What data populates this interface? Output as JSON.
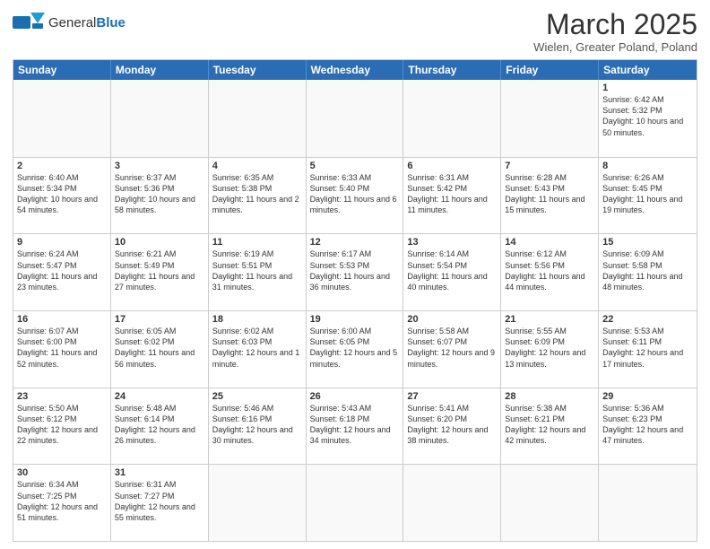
{
  "logo": {
    "text_general": "General",
    "text_blue": "Blue"
  },
  "title": "March 2025",
  "subtitle": "Wielen, Greater Poland, Poland",
  "days_of_week": [
    "Sunday",
    "Monday",
    "Tuesday",
    "Wednesday",
    "Thursday",
    "Friday",
    "Saturday"
  ],
  "weeks": [
    [
      {
        "day": "",
        "info": ""
      },
      {
        "day": "",
        "info": ""
      },
      {
        "day": "",
        "info": ""
      },
      {
        "day": "",
        "info": ""
      },
      {
        "day": "",
        "info": ""
      },
      {
        "day": "",
        "info": ""
      },
      {
        "day": "1",
        "info": "Sunrise: 6:42 AM\nSunset: 5:32 PM\nDaylight: 10 hours and 50 minutes."
      }
    ],
    [
      {
        "day": "2",
        "info": "Sunrise: 6:40 AM\nSunset: 5:34 PM\nDaylight: 10 hours and 54 minutes."
      },
      {
        "day": "3",
        "info": "Sunrise: 6:37 AM\nSunset: 5:36 PM\nDaylight: 10 hours and 58 minutes."
      },
      {
        "day": "4",
        "info": "Sunrise: 6:35 AM\nSunset: 5:38 PM\nDaylight: 11 hours and 2 minutes."
      },
      {
        "day": "5",
        "info": "Sunrise: 6:33 AM\nSunset: 5:40 PM\nDaylight: 11 hours and 6 minutes."
      },
      {
        "day": "6",
        "info": "Sunrise: 6:31 AM\nSunset: 5:42 PM\nDaylight: 11 hours and 11 minutes."
      },
      {
        "day": "7",
        "info": "Sunrise: 6:28 AM\nSunset: 5:43 PM\nDaylight: 11 hours and 15 minutes."
      },
      {
        "day": "8",
        "info": "Sunrise: 6:26 AM\nSunset: 5:45 PM\nDaylight: 11 hours and 19 minutes."
      }
    ],
    [
      {
        "day": "9",
        "info": "Sunrise: 6:24 AM\nSunset: 5:47 PM\nDaylight: 11 hours and 23 minutes."
      },
      {
        "day": "10",
        "info": "Sunrise: 6:21 AM\nSunset: 5:49 PM\nDaylight: 11 hours and 27 minutes."
      },
      {
        "day": "11",
        "info": "Sunrise: 6:19 AM\nSunset: 5:51 PM\nDaylight: 11 hours and 31 minutes."
      },
      {
        "day": "12",
        "info": "Sunrise: 6:17 AM\nSunset: 5:53 PM\nDaylight: 11 hours and 36 minutes."
      },
      {
        "day": "13",
        "info": "Sunrise: 6:14 AM\nSunset: 5:54 PM\nDaylight: 11 hours and 40 minutes."
      },
      {
        "day": "14",
        "info": "Sunrise: 6:12 AM\nSunset: 5:56 PM\nDaylight: 11 hours and 44 minutes."
      },
      {
        "day": "15",
        "info": "Sunrise: 6:09 AM\nSunset: 5:58 PM\nDaylight: 11 hours and 48 minutes."
      }
    ],
    [
      {
        "day": "16",
        "info": "Sunrise: 6:07 AM\nSunset: 6:00 PM\nDaylight: 11 hours and 52 minutes."
      },
      {
        "day": "17",
        "info": "Sunrise: 6:05 AM\nSunset: 6:02 PM\nDaylight: 11 hours and 56 minutes."
      },
      {
        "day": "18",
        "info": "Sunrise: 6:02 AM\nSunset: 6:03 PM\nDaylight: 12 hours and 1 minute."
      },
      {
        "day": "19",
        "info": "Sunrise: 6:00 AM\nSunset: 6:05 PM\nDaylight: 12 hours and 5 minutes."
      },
      {
        "day": "20",
        "info": "Sunrise: 5:58 AM\nSunset: 6:07 PM\nDaylight: 12 hours and 9 minutes."
      },
      {
        "day": "21",
        "info": "Sunrise: 5:55 AM\nSunset: 6:09 PM\nDaylight: 12 hours and 13 minutes."
      },
      {
        "day": "22",
        "info": "Sunrise: 5:53 AM\nSunset: 6:11 PM\nDaylight: 12 hours and 17 minutes."
      }
    ],
    [
      {
        "day": "23",
        "info": "Sunrise: 5:50 AM\nSunset: 6:12 PM\nDaylight: 12 hours and 22 minutes."
      },
      {
        "day": "24",
        "info": "Sunrise: 5:48 AM\nSunset: 6:14 PM\nDaylight: 12 hours and 26 minutes."
      },
      {
        "day": "25",
        "info": "Sunrise: 5:46 AM\nSunset: 6:16 PM\nDaylight: 12 hours and 30 minutes."
      },
      {
        "day": "26",
        "info": "Sunrise: 5:43 AM\nSunset: 6:18 PM\nDaylight: 12 hours and 34 minutes."
      },
      {
        "day": "27",
        "info": "Sunrise: 5:41 AM\nSunset: 6:20 PM\nDaylight: 12 hours and 38 minutes."
      },
      {
        "day": "28",
        "info": "Sunrise: 5:38 AM\nSunset: 6:21 PM\nDaylight: 12 hours and 42 minutes."
      },
      {
        "day": "29",
        "info": "Sunrise: 5:36 AM\nSunset: 6:23 PM\nDaylight: 12 hours and 47 minutes."
      }
    ],
    [
      {
        "day": "30",
        "info": "Sunrise: 6:34 AM\nSunset: 7:25 PM\nDaylight: 12 hours and 51 minutes."
      },
      {
        "day": "31",
        "info": "Sunrise: 6:31 AM\nSunset: 7:27 PM\nDaylight: 12 hours and 55 minutes."
      },
      {
        "day": "",
        "info": ""
      },
      {
        "day": "",
        "info": ""
      },
      {
        "day": "",
        "info": ""
      },
      {
        "day": "",
        "info": ""
      },
      {
        "day": "",
        "info": ""
      }
    ]
  ]
}
